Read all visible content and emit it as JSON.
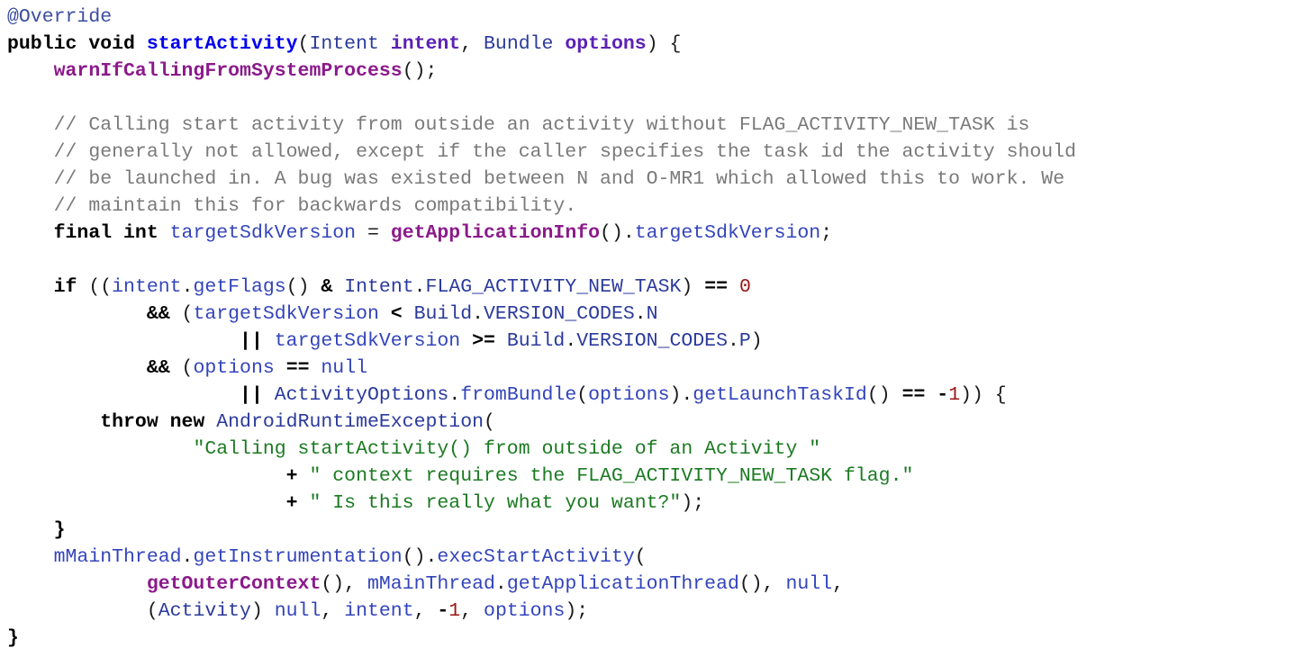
{
  "editor": {
    "language": "java",
    "background_color": "#ffffff",
    "font_size_px": 21.5,
    "line_height_px": 30,
    "total_lines": 23
  },
  "theme": {
    "plain": "#1a1a1a",
    "keyword": "#000000",
    "annotation": "#3b4ea0",
    "method_declaration": "#0000ee",
    "method_call": "#8b1a8b",
    "type": "#2b3a9c",
    "identifier": "#3344bb",
    "parameter": "#5b21b6",
    "number": "#9b1414",
    "string": "#1b7a22",
    "comment": "#7a7a7a"
  },
  "code": {
    "lines": [
      {
        "n": 1,
        "text": "@Override",
        "tokens": [
          {
            "t": "@",
            "c": "annot"
          },
          {
            "t": "Override",
            "c": "annot"
          }
        ]
      },
      {
        "n": 2,
        "text": "public void startActivity(Intent intent, Bundle options) {",
        "tokens": [
          {
            "t": "public void ",
            "c": "keyword"
          },
          {
            "t": "startActivity",
            "c": "method"
          },
          {
            "t": "(",
            "c": "punct"
          },
          {
            "t": "Intent ",
            "c": "type"
          },
          {
            "t": "intent",
            "c": "param"
          },
          {
            "t": ", ",
            "c": "punct"
          },
          {
            "t": "Bundle ",
            "c": "type"
          },
          {
            "t": "options",
            "c": "param"
          },
          {
            "t": ") {",
            "c": "punct"
          }
        ]
      },
      {
        "n": 3,
        "text": "    warnIfCallingFromSystemProcess();",
        "tokens": [
          {
            "t": "    ",
            "c": "plain"
          },
          {
            "t": "warnIfCallingFromSystemProcess",
            "c": "call"
          },
          {
            "t": "();",
            "c": "punct"
          }
        ]
      },
      {
        "n": 4,
        "text": "",
        "tokens": []
      },
      {
        "n": 5,
        "text": "    // Calling start activity from outside an activity without FLAG_ACTIVITY_NEW_TASK is",
        "tokens": [
          {
            "t": "    ",
            "c": "plain"
          },
          {
            "t": "// Calling start activity from outside an activity without FLAG_ACTIVITY_NEW_TASK is",
            "c": "comment"
          }
        ]
      },
      {
        "n": 6,
        "text": "    // generally not allowed, except if the caller specifies the task id the activity should",
        "tokens": [
          {
            "t": "    ",
            "c": "plain"
          },
          {
            "t": "// generally not allowed, except if the caller specifies the task id the activity should",
            "c": "comment"
          }
        ]
      },
      {
        "n": 7,
        "text": "    // be launched in. A bug was existed between N and O-MR1 which allowed this to work. We",
        "tokens": [
          {
            "t": "    ",
            "c": "plain"
          },
          {
            "t": "// be launched in. A bug was existed between N and O-MR1 which allowed this to work. We",
            "c": "comment"
          }
        ]
      },
      {
        "n": 8,
        "text": "    // maintain this for backwards compatibility.",
        "tokens": [
          {
            "t": "    ",
            "c": "plain"
          },
          {
            "t": "// maintain this for backwards compatibility.",
            "c": "comment"
          }
        ]
      },
      {
        "n": 9,
        "text": "    final int targetSdkVersion = getApplicationInfo().targetSdkVersion;",
        "tokens": [
          {
            "t": "    ",
            "c": "plain"
          },
          {
            "t": "final int ",
            "c": "keyword"
          },
          {
            "t": "targetSdkVersion",
            "c": "ident"
          },
          {
            "t": " = ",
            "c": "punct"
          },
          {
            "t": "getApplicationInfo",
            "c": "call"
          },
          {
            "t": "().",
            "c": "punct"
          },
          {
            "t": "targetSdkVersion",
            "c": "field"
          },
          {
            "t": ";",
            "c": "punct"
          }
        ]
      },
      {
        "n": 10,
        "text": "",
        "tokens": []
      },
      {
        "n": 11,
        "text": "    if ((intent.getFlags() & Intent.FLAG_ACTIVITY_NEW_TASK) == 0",
        "tokens": [
          {
            "t": "    ",
            "c": "plain"
          },
          {
            "t": "if ",
            "c": "keyword"
          },
          {
            "t": "((",
            "c": "punct"
          },
          {
            "t": "intent",
            "c": "ident"
          },
          {
            "t": ".",
            "c": "punct"
          },
          {
            "t": "getFlags",
            "c": "ident"
          },
          {
            "t": "() ",
            "c": "punct"
          },
          {
            "t": "&",
            "c": "keyword"
          },
          {
            "t": " ",
            "c": "punct"
          },
          {
            "t": "Intent",
            "c": "type"
          },
          {
            "t": ".",
            "c": "punct"
          },
          {
            "t": "FLAG_ACTIVITY_NEW_TASK",
            "c": "const"
          },
          {
            "t": ") ",
            "c": "punct"
          },
          {
            "t": "==",
            "c": "keyword"
          },
          {
            "t": " ",
            "c": "punct"
          },
          {
            "t": "0",
            "c": "number"
          }
        ]
      },
      {
        "n": 12,
        "text": "            && (targetSdkVersion < Build.VERSION_CODES.N",
        "tokens": [
          {
            "t": "            ",
            "c": "plain"
          },
          {
            "t": "&&",
            "c": "keyword"
          },
          {
            "t": " (",
            "c": "punct"
          },
          {
            "t": "targetSdkVersion",
            "c": "ident"
          },
          {
            "t": " ",
            "c": "punct"
          },
          {
            "t": "<",
            "c": "keyword"
          },
          {
            "t": " ",
            "c": "punct"
          },
          {
            "t": "Build",
            "c": "type"
          },
          {
            "t": ".",
            "c": "punct"
          },
          {
            "t": "VERSION_CODES",
            "c": "const"
          },
          {
            "t": ".",
            "c": "punct"
          },
          {
            "t": "N",
            "c": "const"
          }
        ]
      },
      {
        "n": 13,
        "text": "                    || targetSdkVersion >= Build.VERSION_CODES.P)",
        "tokens": [
          {
            "t": "                    ",
            "c": "plain"
          },
          {
            "t": "||",
            "c": "keyword"
          },
          {
            "t": " ",
            "c": "punct"
          },
          {
            "t": "targetSdkVersion",
            "c": "ident"
          },
          {
            "t": " ",
            "c": "punct"
          },
          {
            "t": ">=",
            "c": "keyword"
          },
          {
            "t": " ",
            "c": "punct"
          },
          {
            "t": "Build",
            "c": "type"
          },
          {
            "t": ".",
            "c": "punct"
          },
          {
            "t": "VERSION_CODES",
            "c": "const"
          },
          {
            "t": ".",
            "c": "punct"
          },
          {
            "t": "P",
            "c": "const"
          },
          {
            "t": ")",
            "c": "punct"
          }
        ]
      },
      {
        "n": 14,
        "text": "            && (options == null",
        "tokens": [
          {
            "t": "            ",
            "c": "plain"
          },
          {
            "t": "&&",
            "c": "keyword"
          },
          {
            "t": " (",
            "c": "punct"
          },
          {
            "t": "options",
            "c": "ident"
          },
          {
            "t": " ",
            "c": "punct"
          },
          {
            "t": "==",
            "c": "keyword"
          },
          {
            "t": " ",
            "c": "punct"
          },
          {
            "t": "null",
            "c": "ident"
          }
        ]
      },
      {
        "n": 15,
        "text": "                    || ActivityOptions.fromBundle(options).getLaunchTaskId() == -1)) {",
        "tokens": [
          {
            "t": "                    ",
            "c": "plain"
          },
          {
            "t": "||",
            "c": "keyword"
          },
          {
            "t": " ",
            "c": "punct"
          },
          {
            "t": "ActivityOptions",
            "c": "type"
          },
          {
            "t": ".",
            "c": "punct"
          },
          {
            "t": "fromBundle",
            "c": "ident"
          },
          {
            "t": "(",
            "c": "punct"
          },
          {
            "t": "options",
            "c": "ident"
          },
          {
            "t": ").",
            "c": "punct"
          },
          {
            "t": "getLaunchTaskId",
            "c": "ident"
          },
          {
            "t": "() ",
            "c": "punct"
          },
          {
            "t": "==",
            "c": "keyword"
          },
          {
            "t": " -",
            "c": "keyword"
          },
          {
            "t": "1",
            "c": "number"
          },
          {
            "t": ")) {",
            "c": "punct"
          }
        ]
      },
      {
        "n": 16,
        "text": "        throw new AndroidRuntimeException(",
        "tokens": [
          {
            "t": "        ",
            "c": "plain"
          },
          {
            "t": "throw new ",
            "c": "keyword"
          },
          {
            "t": "AndroidRuntimeException",
            "c": "type"
          },
          {
            "t": "(",
            "c": "punct"
          }
        ]
      },
      {
        "n": 17,
        "text": "                \"Calling startActivity() from outside of an Activity \"",
        "tokens": [
          {
            "t": "                ",
            "c": "plain"
          },
          {
            "t": "\"Calling startActivity() from outside of an Activity \"",
            "c": "string"
          }
        ]
      },
      {
        "n": 18,
        "text": "                        + \" context requires the FLAG_ACTIVITY_NEW_TASK flag.\"",
        "tokens": [
          {
            "t": "                        ",
            "c": "plain"
          },
          {
            "t": "+",
            "c": "keyword"
          },
          {
            "t": " ",
            "c": "punct"
          },
          {
            "t": "\" context requires the FLAG_ACTIVITY_NEW_TASK flag.\"",
            "c": "string"
          }
        ]
      },
      {
        "n": 19,
        "text": "                        + \" Is this really what you want?\");",
        "tokens": [
          {
            "t": "                        ",
            "c": "plain"
          },
          {
            "t": "+",
            "c": "keyword"
          },
          {
            "t": " ",
            "c": "punct"
          },
          {
            "t": "\" Is this really what you want?\"",
            "c": "string"
          },
          {
            "t": ");",
            "c": "punct"
          }
        ]
      },
      {
        "n": 20,
        "text": "    }",
        "tokens": [
          {
            "t": "    ",
            "c": "plain"
          },
          {
            "t": "}",
            "c": "keyword"
          }
        ]
      },
      {
        "n": 21,
        "text": "    mMainThread.getInstrumentation().execStartActivity(",
        "tokens": [
          {
            "t": "    ",
            "c": "plain"
          },
          {
            "t": "mMainThread",
            "c": "ident"
          },
          {
            "t": ".",
            "c": "punct"
          },
          {
            "t": "getInstrumentation",
            "c": "ident"
          },
          {
            "t": "().",
            "c": "punct"
          },
          {
            "t": "execStartActivity",
            "c": "ident"
          },
          {
            "t": "(",
            "c": "punct"
          }
        ]
      },
      {
        "n": 22,
        "text": "            getOuterContext(), mMainThread.getApplicationThread(), null,",
        "tokens": [
          {
            "t": "            ",
            "c": "plain"
          },
          {
            "t": "getOuterContext",
            "c": "call"
          },
          {
            "t": "(), ",
            "c": "punct"
          },
          {
            "t": "mMainThread",
            "c": "ident"
          },
          {
            "t": ".",
            "c": "punct"
          },
          {
            "t": "getApplicationThread",
            "c": "ident"
          },
          {
            "t": "(), ",
            "c": "punct"
          },
          {
            "t": "null",
            "c": "ident"
          },
          {
            "t": ",",
            "c": "punct"
          }
        ]
      },
      {
        "n": 23,
        "text": "            (Activity) null, intent, -1, options);",
        "tokens": [
          {
            "t": "            ",
            "c": "plain"
          },
          {
            "t": "(",
            "c": "punct"
          },
          {
            "t": "Activity",
            "c": "type"
          },
          {
            "t": ") ",
            "c": "punct"
          },
          {
            "t": "null",
            "c": "ident"
          },
          {
            "t": ", ",
            "c": "punct"
          },
          {
            "t": "intent",
            "c": "ident"
          },
          {
            "t": ", ",
            "c": "punct"
          },
          {
            "t": "-",
            "c": "keyword"
          },
          {
            "t": "1",
            "c": "number"
          },
          {
            "t": ", ",
            "c": "punct"
          },
          {
            "t": "options",
            "c": "ident"
          },
          {
            "t": ");",
            "c": "punct"
          }
        ]
      },
      {
        "n": 24,
        "text": "}",
        "tokens": [
          {
            "t": "}",
            "c": "keyword"
          }
        ]
      }
    ]
  }
}
